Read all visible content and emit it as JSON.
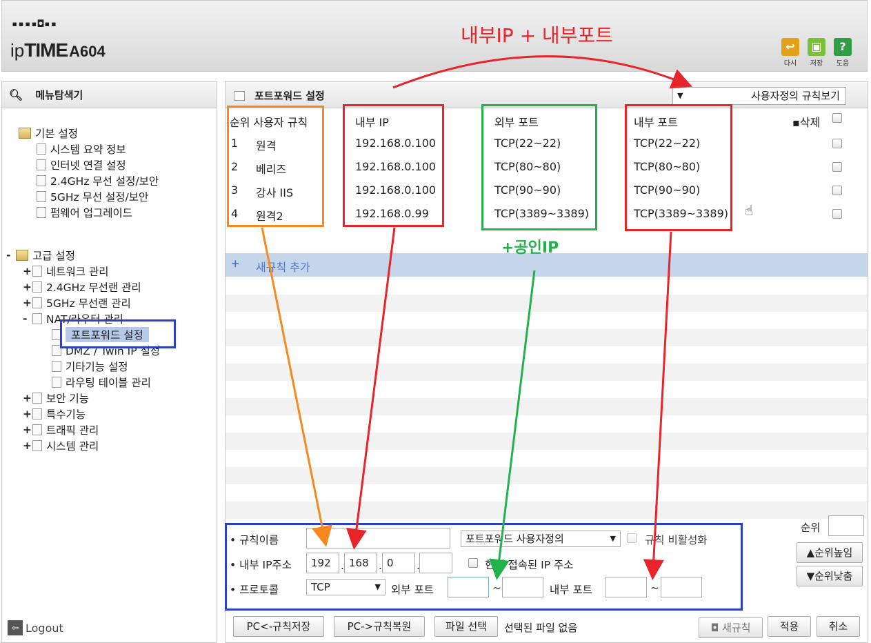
{
  "header": {
    "logo_grid": "▪▪▪▪◘▪▪",
    "logo_brand_prefix": "ip",
    "logo_brand_main": "TIME",
    "logo_model": "A604",
    "buttons": [
      {
        "label": "다시",
        "icon": "undo-icon",
        "color": "#e3a21a"
      },
      {
        "label": "저장",
        "icon": "save-icon",
        "color": "#7bbf3a"
      },
      {
        "label": "도움",
        "icon": "help-icon",
        "color": "#2f9e44"
      }
    ]
  },
  "sidebar": {
    "title": "메뉴탐색기",
    "basic": {
      "label": "기본 설정",
      "items": [
        "시스템 요약 정보",
        "인터넷 연결 설정",
        "2.4GHz 무선 설정/보안",
        "5GHz 무선 설정/보안",
        "펌웨어 업그레이드"
      ]
    },
    "advanced": {
      "label": "고급 설정",
      "toggle": "-",
      "items": [
        {
          "toggle": "+",
          "label": "네트워크 관리"
        },
        {
          "toggle": "+",
          "label": "2.4GHz 무선랜 관리"
        },
        {
          "toggle": "+",
          "label": "5GHz 무선랜 관리"
        },
        {
          "toggle": "-",
          "label": "NAT/라우터 관리"
        }
      ],
      "nat_items": [
        "포트포워드 설정",
        "DMZ / Twin IP 설정",
        "기타기능 설정",
        "라우팅 테이블 관리"
      ],
      "more_items": [
        {
          "toggle": "+",
          "label": "보안 기능"
        },
        {
          "toggle": "+",
          "label": "특수기능"
        },
        {
          "toggle": "+",
          "label": "트래픽 관리"
        },
        {
          "toggle": "+",
          "label": "시스템 관리"
        }
      ]
    },
    "logout": "Logout"
  },
  "main": {
    "title": "포트포워드 설정",
    "view_select": "사용자정의 규칙보기",
    "columns": {
      "rank_rule": "순위 사용자 규칙",
      "internal_ip": "내부 IP",
      "external_port": "외부 포트",
      "internal_port": "내부 포트",
      "delete": "삭제"
    },
    "rows": [
      {
        "rank": "1",
        "name": "원격",
        "ip": "192.168.0.100",
        "ext": "TCP(22~22)",
        "int": "TCP(22~22)"
      },
      {
        "rank": "2",
        "name": "베리즈",
        "ip": "192.168.0.100",
        "ext": "TCP(80~80)",
        "int": "TCP(80~80)"
      },
      {
        "rank": "3",
        "name": "강사 IIS",
        "ip": "192.168.0.100",
        "ext": "TCP(90~90)",
        "int": "TCP(90~90)"
      },
      {
        "rank": "4",
        "name": "원격2",
        "ip": "192.168.0.99",
        "ext": "TCP(3389~3389)",
        "int": "TCP(3389~3389)"
      }
    ],
    "add_rule": "새규칙 추가",
    "add_icon": "+"
  },
  "form": {
    "rule_name_label": "규칙이름",
    "rule_name_value": "",
    "type_select": "포트포워드 사용자정의",
    "disable_label": "규칙 비활성화",
    "ip_label": "내부 IP주소",
    "ip": [
      "192",
      "168",
      "0",
      ""
    ],
    "current_ip_label": "현재 접속된 IP 주소",
    "protocol_label": "프로토콜",
    "protocol_value": "TCP",
    "ext_port_label": "외부 포트",
    "int_port_label": "내부 포트",
    "tilde": "~",
    "rank_label": "순위",
    "rank_up": "▲순위높임",
    "rank_down": "▼순위낮춤"
  },
  "bottom": {
    "save_pc": "PC<-규칙저장",
    "restore_pc": "PC->규칙복원",
    "file_select": "파일 선택",
    "file_status": "선택된 파일 없음",
    "new_rule": "새규칙",
    "apply": "적용",
    "cancel": "취소"
  },
  "annotations": {
    "top_text": "내부IP + 내부포트",
    "public_ip_text": "+공인IP",
    "colors": {
      "red": "#e8232a",
      "orange": "#f7891f",
      "green": "#22b14c",
      "blue": "#2b3fc7"
    }
  }
}
